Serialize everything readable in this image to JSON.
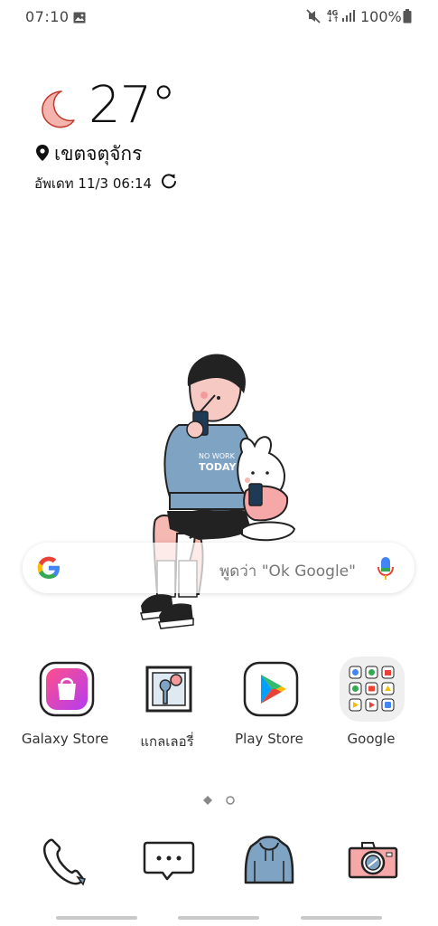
{
  "status_bar": {
    "time": "07:10",
    "network": "4G",
    "battery": "100%",
    "icons": [
      "gallery-notification-icon",
      "mute-icon",
      "signal-icon",
      "battery-icon"
    ]
  },
  "weather": {
    "temperature": "27°",
    "location": "เขตจตุจักร",
    "updated": "อัพเดท 11/3 06:14",
    "icon": "crescent-moon-icon"
  },
  "search": {
    "hint": "พูดว่า \"Ok Google\""
  },
  "apps": [
    {
      "label": "Galaxy Store",
      "icon": "galaxy-store-icon"
    },
    {
      "label": "แกลเลอรี่",
      "icon": "gallery-icon"
    },
    {
      "label": "Play Store",
      "icon": "play-store-icon"
    },
    {
      "label": "Google",
      "icon": "google-folder-icon"
    }
  ],
  "dock": [
    {
      "icon": "phone-icon"
    },
    {
      "icon": "messages-icon"
    },
    {
      "icon": "contacts-hoodie-icon"
    },
    {
      "icon": "camera-icon"
    }
  ],
  "illustration": {
    "hoodie_text": "NO WORK TODAY"
  },
  "colors": {
    "accent_moon": "#f2a7a0",
    "hoodie": "#7fa3c2",
    "rabbit_shirt": "#f6a8a8"
  }
}
